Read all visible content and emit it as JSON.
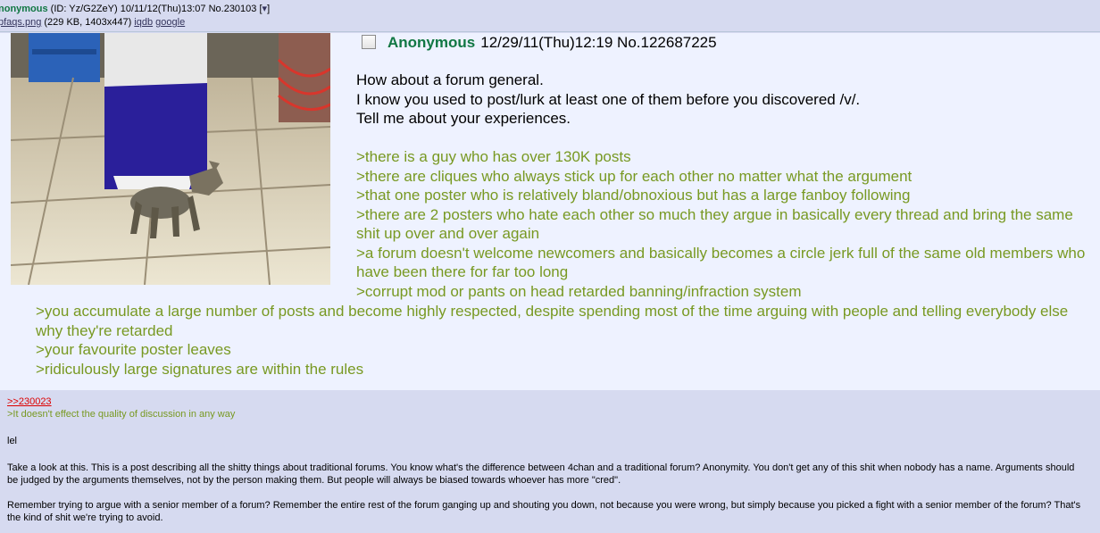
{
  "header": {
    "name": "nonymous",
    "meta": " (ID: Yz/G2ZeY) 10/11/12(Thu)13:07 No.230103 [",
    "arrow": "▾",
    "meta_end": "]",
    "file_name": "pfaqs.png",
    "file_info": " (229 KB, 1403x447) ",
    "link_iqdb": "iqdb",
    "link_google": "google"
  },
  "embed": {
    "thumbnail_alt": "cat wearing plastic bag",
    "post": {
      "name": "Anonymous",
      "date": "12/29/11(Thu)12:19",
      "number": "No.122687225"
    },
    "lines": [
      "How about a forum general.",
      "I know you used to post/lurk at least one of them before you discovered /v/.",
      "Tell me about your experiences."
    ],
    "quotes": [
      ">there is a guy who has over 130K posts",
      ">there are cliques who always stick up for each other no matter what the argument",
      ">that one poster who is relatively bland/obnoxious but has a large fanboy following",
      ">there are 2 posters who hate each other so much they argue in basically every thread and bring the same shit up over and over again",
      ">a forum doesn't welcome newcomers and basically becomes a circle jerk full of the same old members who have been there for far too long",
      ">corrupt mod or pants on head retarded banning/infraction system"
    ],
    "wide_quotes": [
      ">you accumulate a large number of posts and become highly respected, despite spending most of the time arguing with people and telling everybody else why they're retarded",
      ">your favourite poster leaves",
      ">ridiculously large signatures are within the rules"
    ]
  },
  "reply": {
    "ref": ">>230023",
    "quote": ">It doesn't effect the quality of discussion in any way",
    "p1": "lel",
    "p2": "Take a look at this. This is a post describing all the shitty things about traditional forums. You know what's the difference between 4chan and a traditional forum? Anonymity. You don't get any of this shit when nobody has a name. Arguments should be judged by the arguments themselves, not by the person making them. But people will always be biased towards whoever has more \"cred\".",
    "p3": "Remember trying to argue with a senior member of a forum? Remember the entire rest of the forum ganging up and shouting you down, not because you were wrong, but simply because you picked a fight with a senior member of the forum? That's the kind of shit we're trying to avoid."
  }
}
